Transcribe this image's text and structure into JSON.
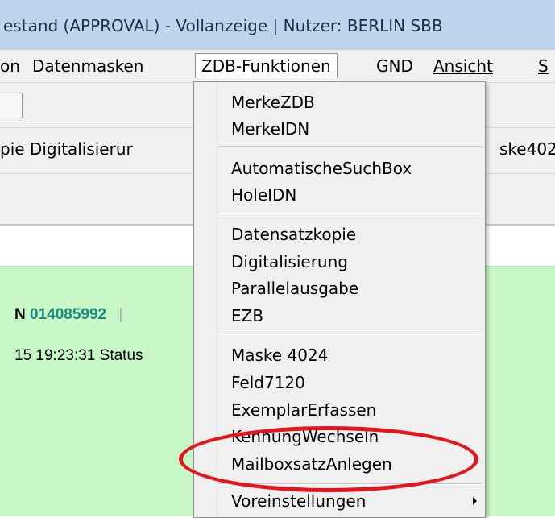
{
  "window": {
    "title": "estand (APPROVAL) - Vollanzeige | Nutzer: BERLIN SBB"
  },
  "menubar": {
    "items": [
      {
        "label": "on"
      },
      {
        "label": "Datenmasken"
      },
      {
        "label": "ZDB-Funktionen"
      },
      {
        "label": "GND"
      },
      {
        "label": "Ansicht"
      },
      {
        "label": "S"
      }
    ]
  },
  "toolbar2": {
    "left_text": "pie  Digitalisierur",
    "right_text": "ske402"
  },
  "record": {
    "label_fragment": "N",
    "id": "014085992",
    "separator": "|",
    "date_status": "15 19:23:31 Status"
  },
  "dropdown": {
    "groups": [
      [
        "MerkeZDB",
        "MerkeIDN"
      ],
      [
        "AutomatischeSuchBox",
        "HoleIDN"
      ],
      [
        "Datensatzkopie",
        "Digitalisierung",
        "Parallelausgabe",
        "EZB"
      ],
      [
        "Maske 4024",
        "Feld7120",
        "ExemplarErfassen",
        "KennungWechseln",
        "MailboxsatzAnlegen"
      ],
      [
        "Voreinstellungen"
      ]
    ],
    "submenu_item": "Voreinstellungen",
    "highlighted_item": "MailboxsatzAnlegen"
  },
  "colors": {
    "titlebar": "#bfd3ea",
    "menu_bg": "#f0f0f0",
    "green_panel": "#c8f7c8",
    "record_id": "#1a8a7a",
    "highlight": "#e8141c"
  }
}
